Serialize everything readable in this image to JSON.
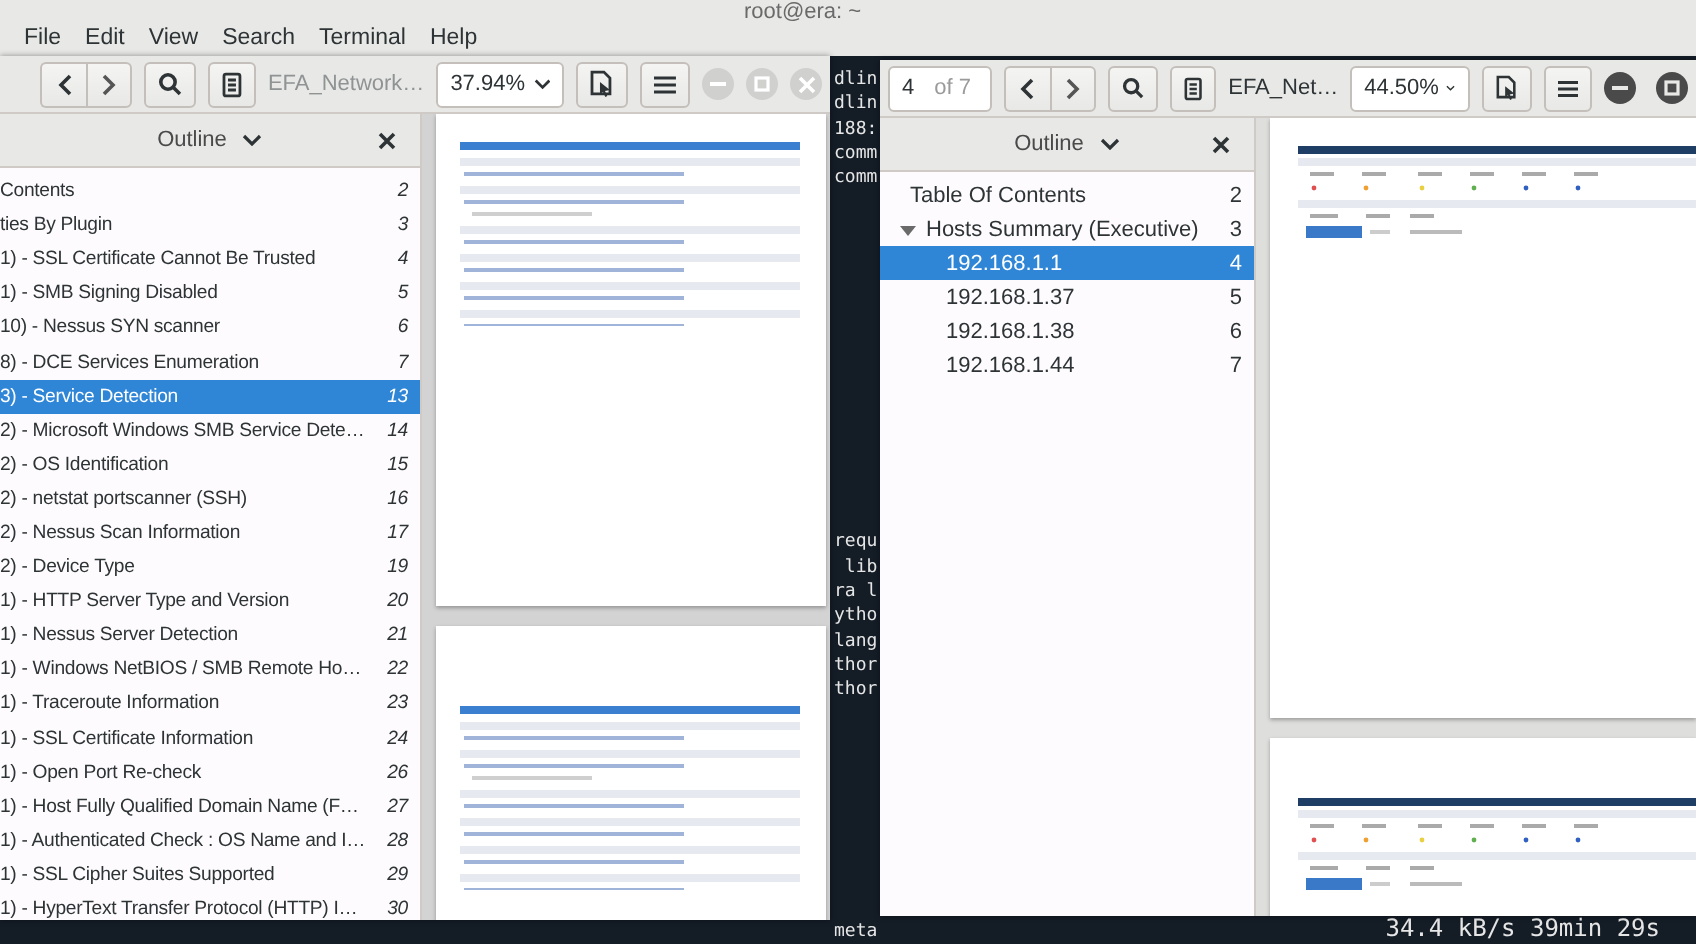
{
  "terminal": {
    "title": "root@era: ~",
    "menu": [
      "File",
      "Edit",
      "View",
      "Search",
      "Terminal",
      "Help"
    ],
    "output_blocks": [
      [
        "dlin",
        "dlin",
        "188:",
        "comm",
        "comm"
      ],
      [
        "requ",
        " lib",
        "ra l",
        "ytho",
        "lang",
        "thor",
        "thor"
      ],
      [
        "meta"
      ]
    ],
    "status": "34.4 kB/s 39min 29s"
  },
  "viewers": [
    {
      "active": false,
      "title": "EFA_Network…",
      "zoom": "37.94%",
      "outline": {
        "title": "Outline",
        "items": [
          {
            "label": "Contents",
            "page": "2",
            "selected": false
          },
          {
            "label": "ties By Plugin",
            "page": "3",
            "selected": false
          },
          {
            "label": "1) - SSL Certificate Cannot Be Trusted",
            "page": "4",
            "selected": false
          },
          {
            "label": "1) - SMB Signing Disabled",
            "page": "5",
            "selected": false
          },
          {
            "label": "10) - Nessus SYN scanner",
            "page": "6",
            "selected": false
          },
          {
            "label": "8) - DCE Services Enumeration",
            "page": "7",
            "selected": false
          },
          {
            "label": "3) - Service Detection",
            "page": "13",
            "selected": true
          },
          {
            "label": "2) - Microsoft Windows SMB Service Dete…",
            "page": "14",
            "selected": false
          },
          {
            "label": "2) - OS Identification",
            "page": "15",
            "selected": false
          },
          {
            "label": "2) - netstat portscanner (SSH)",
            "page": "16",
            "selected": false
          },
          {
            "label": "2) - Nessus Scan Information",
            "page": "17",
            "selected": false
          },
          {
            "label": "2) - Device Type",
            "page": "19",
            "selected": false
          },
          {
            "label": "1) - HTTP Server Type and Version",
            "page": "20",
            "selected": false
          },
          {
            "label": "1) - Nessus Server Detection",
            "page": "21",
            "selected": false
          },
          {
            "label": "1) - Windows NetBIOS / SMB Remote Ho…",
            "page": "22",
            "selected": false
          },
          {
            "label": "1) - Traceroute Information",
            "page": "23",
            "selected": false
          },
          {
            "label": "1) - SSL Certificate Information",
            "page": "24",
            "selected": false
          },
          {
            "label": "1) - Open Port Re-check",
            "page": "26",
            "selected": false
          },
          {
            "label": "1) - Host Fully Qualified Domain Name (F…",
            "page": "27",
            "selected": false
          },
          {
            "label": "1) - Authenticated Check : OS Name and I…",
            "page": "28",
            "selected": false
          },
          {
            "label": "1) - SSL Cipher Suites Supported",
            "page": "29",
            "selected": false
          },
          {
            "label": "1) - HyperText Transfer Protocol (HTTP) I…",
            "page": "30",
            "selected": false
          }
        ]
      }
    },
    {
      "active": true,
      "page_field": {
        "value": "4",
        "total": "of 7"
      },
      "title": "EFA_Net…",
      "zoom": "44.50%",
      "outline": {
        "title": "Outline",
        "items": [
          {
            "label": "Table Of Contents",
            "page": "2",
            "selected": false
          },
          {
            "label": "Hosts Summary (Executive)",
            "page": "3",
            "selected": false,
            "expanded": true,
            "children": [
              {
                "label": "192.168.1.1",
                "page": "4",
                "selected": true
              },
              {
                "label": "192.168.1.37",
                "page": "5",
                "selected": false
              },
              {
                "label": "192.168.1.38",
                "page": "6",
                "selected": false
              },
              {
                "label": "192.168.1.44",
                "page": "7",
                "selected": false
              }
            ]
          }
        ]
      }
    }
  ]
}
